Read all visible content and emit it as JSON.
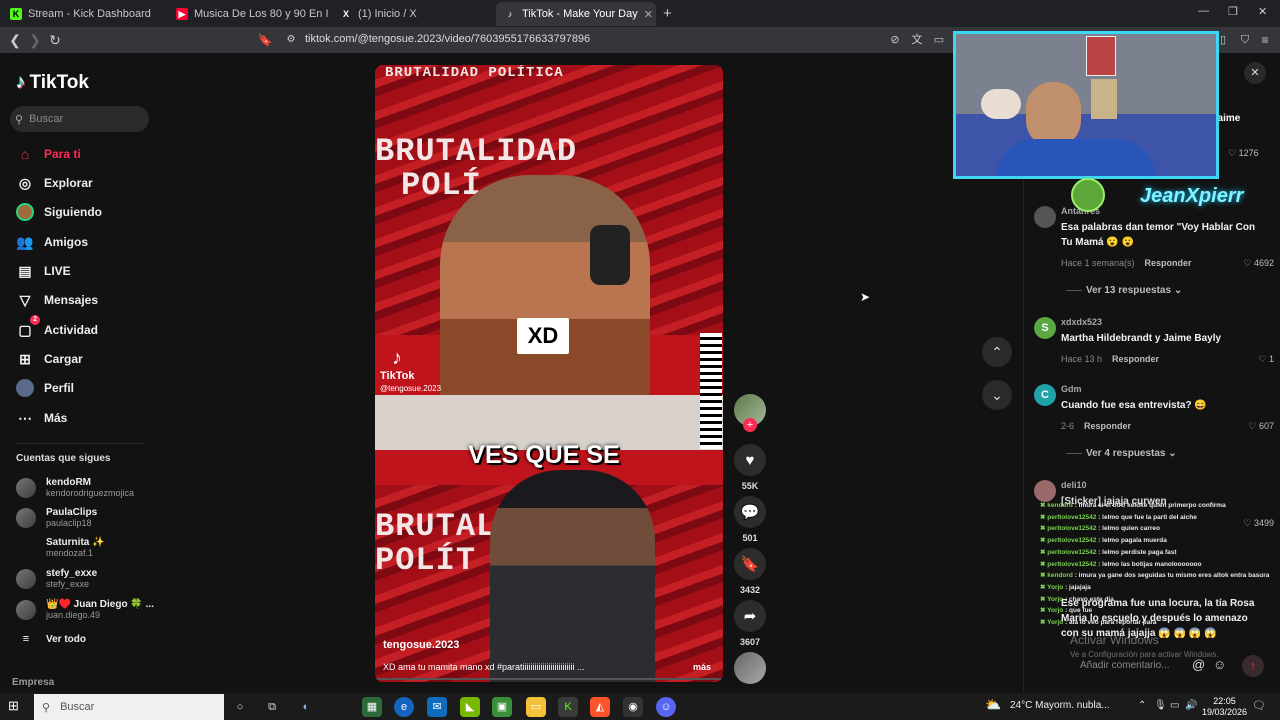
{
  "tabs": [
    {
      "label": "Stream - Kick Dashboard",
      "icon": "kick-icon",
      "color": "#53fc18"
    },
    {
      "label": "Musica De Los 80 y 90 En Ingles - La",
      "icon": "youtube-icon",
      "color": "#ff0033"
    },
    {
      "label": "(1) Inicio / X",
      "icon": "x-icon",
      "color": "#ffffff"
    },
    {
      "label": "TikTok - Make Your Day",
      "icon": "tiktok-icon",
      "color": "#ffffff",
      "active": true
    }
  ],
  "address": {
    "url": "tiktok.com/@tengosue.2023/video/7603955176633797896"
  },
  "sidebar": {
    "logo": "TikTok",
    "search_placeholder": "Buscar",
    "nav": [
      {
        "label": "Para ti",
        "icon": "home-icon"
      },
      {
        "label": "Explorar",
        "icon": "compass-icon"
      },
      {
        "label": "Siguiendo",
        "icon": "following-icon"
      },
      {
        "label": "Amigos",
        "icon": "friends-icon"
      },
      {
        "label": "LIVE",
        "icon": "live-icon"
      },
      {
        "label": "Mensajes",
        "icon": "messages-icon"
      },
      {
        "label": "Actividad",
        "icon": "activity-icon",
        "badge": "2"
      },
      {
        "label": "Cargar",
        "icon": "upload-icon"
      },
      {
        "label": "Perfil",
        "icon": "profile-icon"
      },
      {
        "label": "Más",
        "icon": "more-icon"
      }
    ],
    "follows_title": "Cuentas que sigues",
    "follows": [
      {
        "name": "kendoRM",
        "handle": "kendorodriguezmojica"
      },
      {
        "name": "PaulaClips",
        "handle": "paulaclip18"
      },
      {
        "name": "Saturnita ✨",
        "handle": "mendozaf.1"
      },
      {
        "name": "stefy_exxe",
        "handle": "stefy_exxe"
      },
      {
        "name": "👑♥️ Juan Diego 🍀 ...",
        "handle": "juan.diego.49"
      }
    ],
    "see_all": "Ver todo",
    "footer": "Empresa"
  },
  "video": {
    "watermark_top": "BRUTALIDAD POLÍTICA",
    "watermark_band1": "BRUTALIDAD",
    "watermark_band1b": "POLÍ",
    "watermark_band2": "BRUTALIDAD",
    "watermark_band2b": "POLÍT",
    "sticker": "XD",
    "caption": "VES QUE SE",
    "tiktok_watermark": "TikTok",
    "watermark_user": "@tengosue.2023",
    "author": "tengosue.2023",
    "description": "XD ama tu mamita mano xd #paratiiiiiiiiiiiiiiiiiiiiiiiiii ...",
    "more": "más"
  },
  "actions": {
    "likes": "55K",
    "comments": "501",
    "saves": "3432",
    "shares": "3607"
  },
  "comments": [
    {
      "user": "Antanres",
      "text": "Esa palabras dan temor \"Voy Hablar Con Tu Mamá 😮 😮",
      "time": "Hace 1 semana(s)",
      "reply": "Responder",
      "likes": "4692",
      "replies": "Ver 13 respuestas",
      "avatar_color": "#555"
    },
    {
      "user": "xdxdx523",
      "text": "Martha Hildebrandt y Jaime Bayly",
      "time": "Hace 13 h",
      "reply": "Responder",
      "likes": "1",
      "avatar_color": "#5ba842",
      "initial": "S"
    },
    {
      "user": "Gdm",
      "text": "Cuando fue esa entrevista? 😄",
      "time": "2-6",
      "reply": "Responder",
      "likes": "607",
      "replies": "Ver 4 respuestas",
      "avatar_color": "#1fa3a8",
      "initial": "C"
    },
    {
      "user": "deli10",
      "text": "[Sticker] jajaja curwen",
      "likes": "3499",
      "avatar_color": "#9a6a6a"
    }
  ],
  "partial": {
    "top_name": "Jaime",
    "top_likes": "1276"
  },
  "last_comment": {
    "text": "Ese programa fue una locura, la tía Rosa Maria lo escuelo y después lo amenazo con su mamá jajajja 😱 😱 😱 😱"
  },
  "chat": [
    {
      "name": "kendord",
      "msg": "imura si el otro keloke quien primerpo confirma"
    },
    {
      "name": "perltolove12542",
      "msg": "lelmo que fue la parti del aiche"
    },
    {
      "name": "perltolove12542",
      "msg": "lelmo quien carreo"
    },
    {
      "name": "perltolove12542",
      "msg": "lelmo pagala muerda"
    },
    {
      "name": "perltolove12542",
      "msg": "lelmo perdiste paga fast"
    },
    {
      "name": "perltolove12542",
      "msg": "lelmo las botijas manolooooooo"
    },
    {
      "name": "kendord",
      "msg": "imura ya gane dos seguidas tu mismo eres altok entra basura"
    },
    {
      "name": "Yorjo",
      "msg": "jajajaja"
    },
    {
      "name": "Yorjo",
      "msg": "chavo este dia"
    },
    {
      "name": "Yorjo",
      "msg": "que fue"
    },
    {
      "name": "Yorjo",
      "msg": "ala lo veo para reportar para"
    }
  ],
  "comment_input": {
    "placeholder": "Añadir comentario..."
  },
  "overlay": {
    "streamer": "JeanXpierr",
    "activate_title": "Activar Windows",
    "activate_sub": "Ve a Configuración para activar Windows."
  },
  "taskbar": {
    "search": "Buscar",
    "weather": "24°C  Mayorm. nubla...",
    "time": "22:05",
    "date": "19/03/2026"
  }
}
